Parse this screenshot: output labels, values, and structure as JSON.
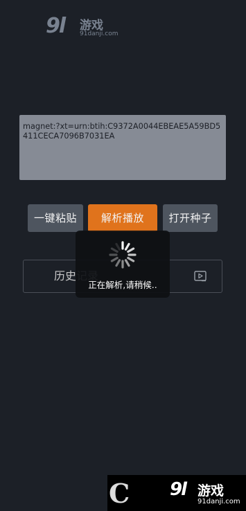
{
  "watermark_top": {
    "number": "9",
    "letter": "l",
    "brand": "游戏",
    "domain": "91danji.com"
  },
  "input": {
    "value": "magnet:?xt=urn:btih:C9372A0044EBEAE5A59BD5411CECA7096B7031EA"
  },
  "buttons": {
    "paste": "一键粘贴",
    "play": "解析播放",
    "open_seed": "打开种子"
  },
  "history": {
    "label": "历史记录",
    "icon": "video-play-icon"
  },
  "loading": {
    "message": "正在解析,请稍候.."
  },
  "watermark_bottom": {
    "number": "9",
    "letter": "l",
    "brand": "游戏",
    "domain": "91danji.com",
    "logo_letter": "C"
  },
  "colors": {
    "background": "#1c2027",
    "accent": "#e0731c",
    "button": "#4e555f",
    "input": "#868b95"
  }
}
